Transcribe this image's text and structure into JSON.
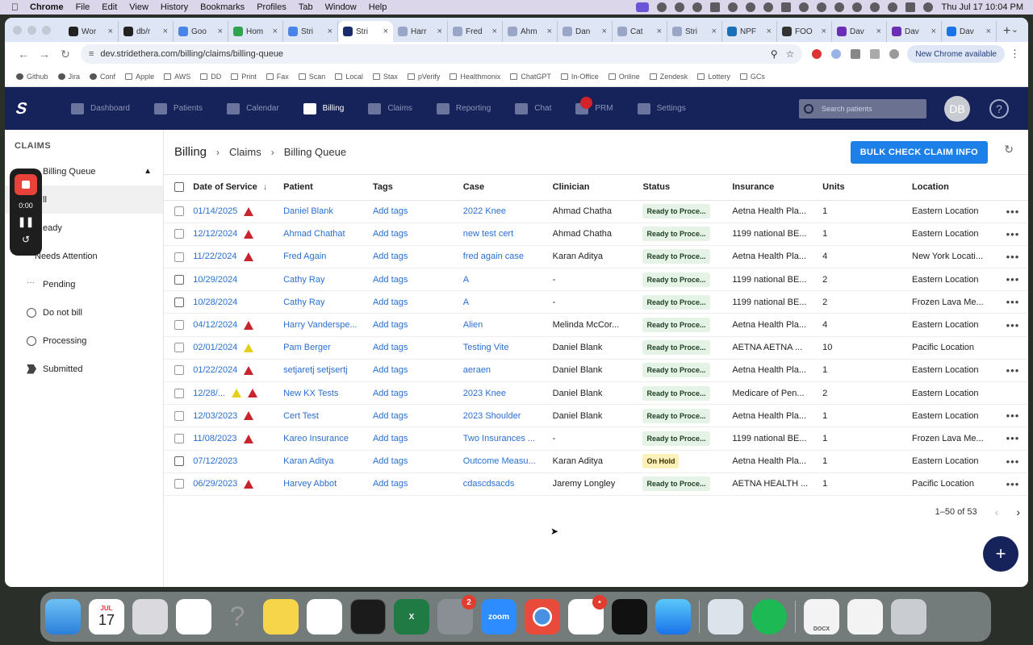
{
  "menubar": {
    "items": [
      "Chrome",
      "File",
      "Edit",
      "View",
      "History",
      "Bookmarks",
      "Profiles",
      "Tab",
      "Window",
      "Help"
    ],
    "clock": "Thu Jul 17  10:04 PM"
  },
  "browser": {
    "tabs": [
      {
        "label": "Wor",
        "color": "#222"
      },
      {
        "label": "db/r",
        "color": "#222"
      },
      {
        "label": "Goo",
        "color": "#4a84e8"
      },
      {
        "label": "Hom",
        "color": "#2fa44f"
      },
      {
        "label": "Stri",
        "color": "#4a84e8"
      },
      {
        "label": "Stri",
        "color": "#1a2a6a",
        "active": true
      },
      {
        "label": "Harr",
        "color": "#9aa6c6"
      },
      {
        "label": "Fred",
        "color": "#9aa6c6"
      },
      {
        "label": "Ahm",
        "color": "#9aa6c6"
      },
      {
        "label": "Dan",
        "color": "#9aa6c6"
      },
      {
        "label": "Cat",
        "color": "#9aa6c6"
      },
      {
        "label": "Stri",
        "color": "#9aa6c6"
      },
      {
        "label": "NPF",
        "color": "#1b6fb5"
      },
      {
        "label": "FOO",
        "color": "#333"
      },
      {
        "label": "Dav",
        "color": "#6b2fb5"
      },
      {
        "label": "Dav",
        "color": "#6b2fb5"
      },
      {
        "label": "Dav",
        "color": "#1a73e8"
      }
    ],
    "url": "dev.stridethera.com/billing/claims/billing-queue",
    "new_chrome_label": "New Chrome available",
    "profile_initial": "D",
    "bookmarks": [
      "Github",
      "Jira",
      "Conf",
      "Apple",
      "AWS",
      "DD",
      "Print",
      "Fax",
      "Scan",
      "Local",
      "Stax",
      "pVerify",
      "Healthmonix",
      "ChatGPT",
      "In-Office",
      "Online",
      "Zendesk",
      "Lottery",
      "GCs"
    ]
  },
  "app_nav": {
    "items": [
      "Dashboard",
      "Patients",
      "Calendar",
      "Billing",
      "Claims",
      "Reporting",
      "Chat",
      "PRM",
      "Settings"
    ],
    "active": "Billing",
    "search_placeholder": "Search patients",
    "avatar_initials": "DB",
    "help_glyph": "?"
  },
  "sidebar": {
    "header": "CLAIMS",
    "group_label": "Billing Queue",
    "items": [
      {
        "label": "ll",
        "selected": true
      },
      {
        "label": "eady"
      },
      {
        "label": "Needs Attention"
      },
      {
        "label": "Pending"
      },
      {
        "label": "Do not bill"
      },
      {
        "label": "Processing"
      },
      {
        "label": "Submitted"
      }
    ]
  },
  "recorder": {
    "time": "0:00"
  },
  "breadcrumb": {
    "items": [
      "Billing",
      "Claims",
      "Billing Queue"
    ]
  },
  "actions": {
    "bulk_check_label": "BULK CHECK CLAIM INFO"
  },
  "table": {
    "columns": [
      "Date of Service",
      "Patient",
      "Tags",
      "Case",
      "Clinician",
      "Status",
      "Insurance",
      "Units",
      "Location"
    ],
    "sort_indicator": "↓",
    "rows": [
      {
        "date": "01/14/2025",
        "warn": [
          "red"
        ],
        "patient": "Daniel Blank",
        "tags": "Add tags",
        "case": "2022 Knee",
        "clinician": "Ahmad Chatha",
        "status": "Ready to Proce...",
        "status_type": "ready",
        "insurance": "Aetna Health Pla...",
        "units": "1",
        "location": "Eastern Location",
        "more": true
      },
      {
        "date": "12/12/2024",
        "warn": [
          "red"
        ],
        "patient": "Ahmad Chathat",
        "tags": "Add tags",
        "case": "new test cert",
        "clinician": "Ahmad Chatha",
        "status": "Ready to Proce...",
        "status_type": "ready",
        "insurance": "1199 national BE...",
        "units": "1",
        "location": "Eastern Location",
        "more": true
      },
      {
        "date": "11/22/2024",
        "warn": [
          "red"
        ],
        "patient": "Fred Again",
        "tags": "Add tags",
        "case": "fred again case",
        "clinician": "Karan Aditya",
        "status": "Ready to Proce...",
        "status_type": "ready",
        "insurance": "Aetna Health Pla...",
        "units": "4",
        "location": "New York Locati...",
        "more": true
      },
      {
        "date": "10/29/2024",
        "warn": [],
        "patient": "Cathy Ray",
        "tags": "Add tags",
        "case": "A",
        "clinician": "-",
        "status": "Ready to Proce...",
        "status_type": "ready",
        "insurance": "1199 national BE...",
        "units": "2",
        "location": "Eastern Location",
        "more": true
      },
      {
        "date": "10/28/2024",
        "warn": [],
        "patient": "Cathy Ray",
        "tags": "Add tags",
        "case": "A",
        "clinician": "-",
        "status": "Ready to Proce...",
        "status_type": "ready",
        "insurance": "1199 national BE...",
        "units": "2",
        "location": "Frozen Lava Me...",
        "more": true
      },
      {
        "date": "04/12/2024",
        "warn": [
          "red"
        ],
        "patient": "Harry Vanderspe...",
        "tags": "Add tags",
        "case": "Alien",
        "clinician": "Melinda McCor...",
        "status": "Ready to Proce...",
        "status_type": "ready",
        "insurance": "Aetna Health Pla...",
        "units": "4",
        "location": "Eastern Location",
        "more": true
      },
      {
        "date": "02/01/2024",
        "warn": [
          "yellow"
        ],
        "patient": "Pam Berger",
        "tags": "Add tags",
        "case": "Testing Vite",
        "clinician": "Daniel Blank",
        "status": "Ready to Proce...",
        "status_type": "ready",
        "insurance": "AETNA AETNA ...",
        "units": "10",
        "location": "Pacific Location",
        "more": false
      },
      {
        "date": "01/22/2024",
        "warn": [
          "red"
        ],
        "patient": "setjaretj setjsertj",
        "tags": "Add tags",
        "case": "aeraen",
        "clinician": "Daniel Blank",
        "status": "Ready to Proce...",
        "status_type": "ready",
        "insurance": "Aetna Health Pla...",
        "units": "1",
        "location": "Eastern Location",
        "more": true
      },
      {
        "date": "12/28/...",
        "warn": [
          "yellow",
          "red"
        ],
        "patient": "New KX Tests",
        "tags": "Add tags",
        "case": "2023 Knee",
        "clinician": "Daniel Blank",
        "status": "Ready to Proce...",
        "status_type": "ready",
        "insurance": "Medicare of Pen...",
        "units": "2",
        "location": "Eastern Location",
        "more": false
      },
      {
        "date": "12/03/2023",
        "warn": [
          "red"
        ],
        "patient": "Cert Test",
        "tags": "Add tags",
        "case": "2023 Shoulder",
        "clinician": "Daniel Blank",
        "status": "Ready to Proce...",
        "status_type": "ready",
        "insurance": "Aetna Health Pla...",
        "units": "1",
        "location": "Eastern Location",
        "more": true
      },
      {
        "date": "11/08/2023",
        "warn": [
          "red"
        ],
        "patient": "Kareo Insurance",
        "tags": "Add tags",
        "case": "Two Insurances ...",
        "clinician": "-",
        "status": "Ready to Proce...",
        "status_type": "ready",
        "insurance": "1199 national BE...",
        "units": "1",
        "location": "Frozen Lava Me...",
        "more": true
      },
      {
        "date": "07/12/2023",
        "warn": [],
        "patient": "Karan Aditya",
        "tags": "Add tags",
        "case": "Outcome Measu...",
        "clinician": "Karan Aditya",
        "status": "On Hold",
        "status_type": "hold",
        "insurance": "Aetna Health Pla...",
        "units": "1",
        "location": "Eastern Location",
        "more": true
      },
      {
        "date": "06/29/2023",
        "warn": [
          "red"
        ],
        "patient": "Harvey Abbot",
        "tags": "Add tags",
        "case": "cdascdsacds",
        "clinician": "Jaremy Longley",
        "status": "Ready to Proce...",
        "status_type": "ready",
        "insurance": "AETNA HEALTH ...",
        "units": "1",
        "location": "Pacific Location",
        "more": true
      }
    ]
  },
  "pagination": {
    "range_label": "1–50 of 53"
  },
  "dock": {
    "calendar_month": "JUL",
    "calendar_day": "17",
    "settings_badge": "2",
    "slack_badge": "•",
    "zoom_label": "zoom",
    "docx_label": "DOCX"
  }
}
